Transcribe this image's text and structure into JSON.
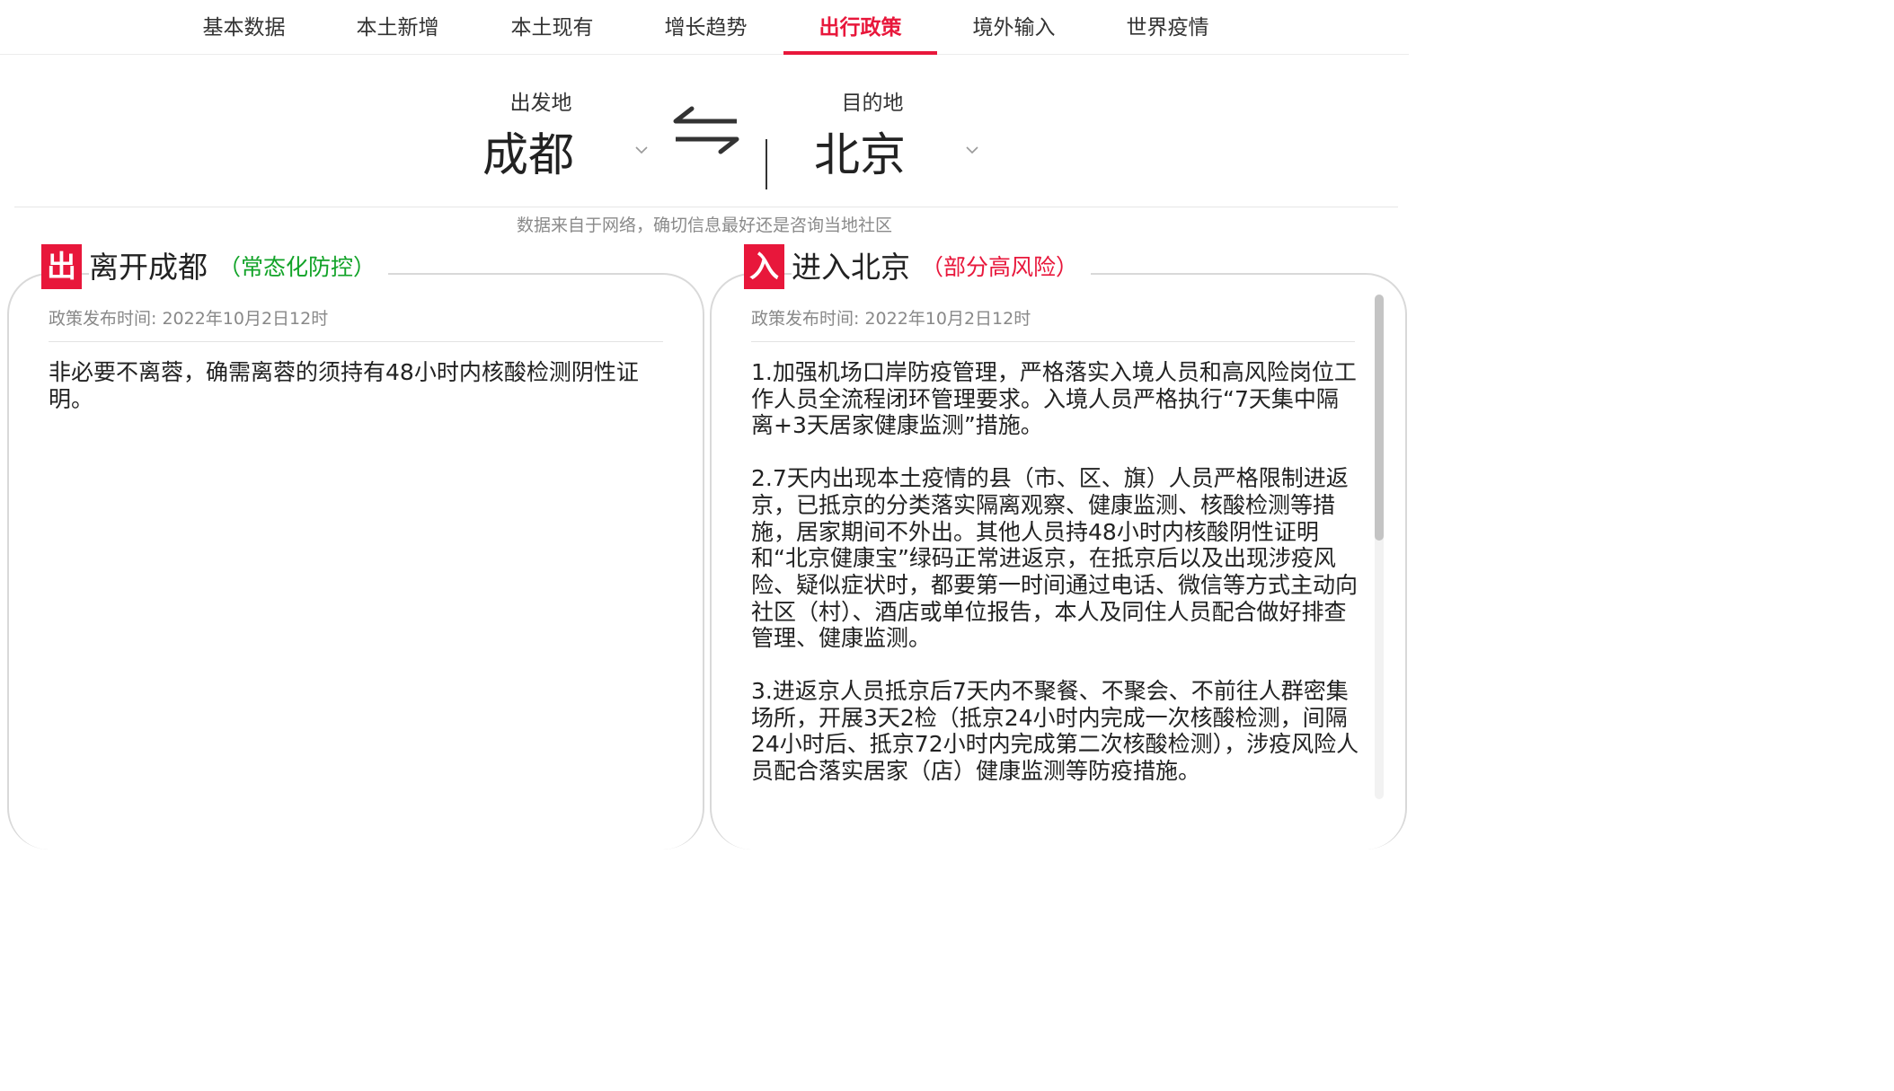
{
  "tabs": [
    {
      "label": "基本数据",
      "active": false
    },
    {
      "label": "本土新增",
      "active": false
    },
    {
      "label": "本土现有",
      "active": false
    },
    {
      "label": "增长趋势",
      "active": false
    },
    {
      "label": "出行政策",
      "active": true
    },
    {
      "label": "境外输入",
      "active": false
    },
    {
      "label": "世界疫情",
      "active": false
    }
  ],
  "route": {
    "origin_caption": "出发地",
    "origin_city": "成都",
    "destination_caption": "目的地",
    "destination_city": "北京"
  },
  "source_note": "数据来自于网络，确切信息最好还是咨询当地社区",
  "leave_panel": {
    "badge": "出",
    "title": "离开成都",
    "risk": "（常态化防控）",
    "risk_color": "#12a328",
    "publish_time": "政策发布时间: 2022年10月2日12时",
    "text": "非必要不离蓉，确需离蓉的须持有48小时内核酸检测阴性证明。"
  },
  "enter_panel": {
    "badge": "入",
    "title": "进入北京",
    "risk": "（部分高风险）",
    "risk_color": "#e8173b",
    "publish_time": "政策发布时间: 2022年10月2日12时",
    "paragraphs": [
      "1.加强机场口岸防疫管理，严格落实入境人员和高风险岗位工作人员全流程闭环管理要求。入境人员严格执行“7天集中隔离+3天居家健康监测”措施。",
      "2.7天内出现本土疫情的县（市、区、旗）人员严格限制进返京，已抵京的分类落实隔离观察、健康监测、核酸检测等措施，居家期间不外出。其他人员持48小时内核酸阴性证明和“北京健康宝”绿码正常进返京，在抵京后以及出现涉疫风险、疑似症状时，都要第一时间通过电话、微信等方式主动向社区（村）、酒店或单位报告，本人及同住人员配合做好排查管理、健康监测。",
      "3.进返京人员抵京后7天内不聚餐、不聚会、不前往人群密集场所，开展3天2检（抵京24小时内完成一次核酸检测，间隔24小时后、抵京72小时内完成第二次核酸检测），涉疫风险人员配合落实居家（店）健康监测等防疫措施。"
    ]
  },
  "icons": {
    "swap": "swap-arrows-icon",
    "origin_dropdown": "chevron-down-icon",
    "destination_dropdown": "chevron-down-icon"
  },
  "colors": {
    "accent": "#e8173b",
    "low_risk": "#12a328",
    "high_risk": "#e8173b"
  }
}
